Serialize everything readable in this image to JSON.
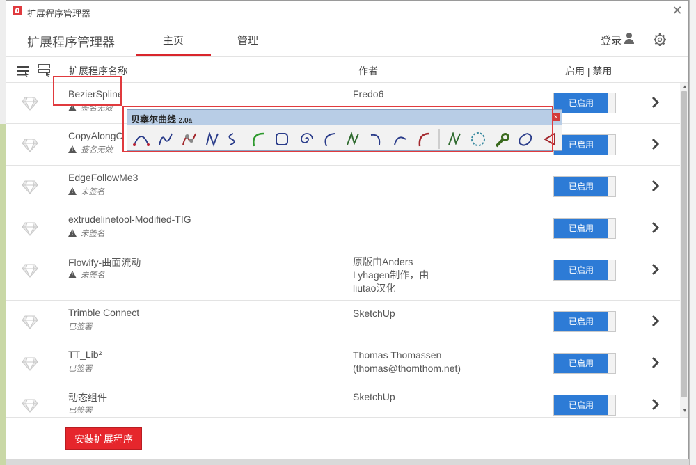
{
  "window": {
    "title": "扩展程序管理器"
  },
  "nav": {
    "title": "扩展程序管理器",
    "tab_home": "主页",
    "tab_manage": "管理",
    "login": "登录"
  },
  "table_header": {
    "name": "扩展程序名称",
    "author": "作者",
    "enable": "启用 | 禁用"
  },
  "extensions": [
    {
      "name": "BezierSpline",
      "status": "签名无效",
      "warning": true,
      "author": [
        "Fredo6"
      ],
      "toggle": "已启用"
    },
    {
      "name": "CopyAlongC",
      "status": "签名无效",
      "warning": true,
      "author": [],
      "toggle": "已启用"
    },
    {
      "name": "EdgeFollowMe3",
      "status": "未签名",
      "warning": true,
      "author": [],
      "toggle": "已启用"
    },
    {
      "name": "extrudelinetool-Modified-TIG",
      "status": "未签名",
      "warning": true,
      "author": [],
      "toggle": "已启用"
    },
    {
      "name": "Flowify-曲面流动",
      "status": "未签名",
      "warning": true,
      "author": [
        "原版由Anders",
        "Lyhagen制作，由",
        "liutao汉化"
      ],
      "toggle": "已启用"
    },
    {
      "name": "Trimble Connect",
      "status": "已签署",
      "warning": false,
      "author": [
        "SketchUp"
      ],
      "toggle": "已启用"
    },
    {
      "name": "TT_Lib²",
      "status": "已签署",
      "warning": false,
      "author": [
        "Thomas Thomassen",
        "(thomas@thomthom.net)"
      ],
      "toggle": "已启用"
    },
    {
      "name": "动态组件",
      "status": "已签署",
      "warning": false,
      "author": [
        "SketchUp"
      ],
      "toggle": "已启用"
    }
  ],
  "footer": {
    "install_button": "安装扩展程序"
  },
  "toolbar_popup": {
    "title": "贝塞尔曲线",
    "version": "2.0a",
    "tools": [
      "bezier-arch-icon",
      "spline-n-icon",
      "spline-dots-icon",
      "spline-n2-icon",
      "s-curve-icon",
      "arc-green-icon",
      "rounded-square-icon",
      "spiral-icon",
      "c-curve-icon",
      "zigzag-green-icon",
      "hook-curve-icon",
      "half-arc-icon",
      "red-arc-icon",
      "separator",
      "zigzag-icon",
      "polygon-dots-icon",
      "wrench-icon",
      "closed-curve-icon",
      "arrow-curve-icon"
    ]
  },
  "colors": {
    "accent_red": "#e6262c",
    "toggle_blue": "#2d7bd6",
    "popup_title_bg": "#b8cde6"
  }
}
